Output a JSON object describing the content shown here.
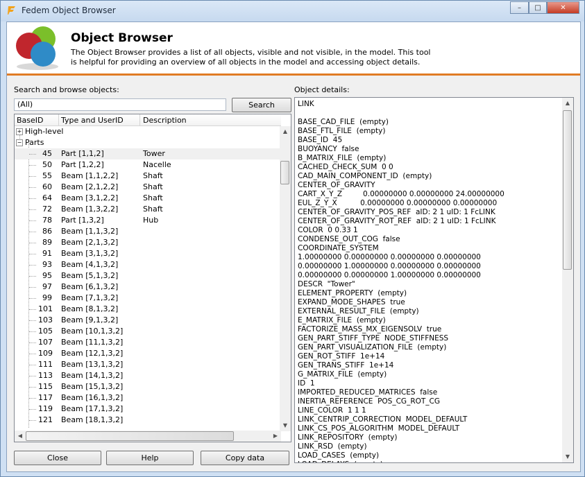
{
  "window": {
    "title": "Fedem Object Browser",
    "controls": {
      "minimize": "–",
      "maximize": "□",
      "close": "✕"
    }
  },
  "header": {
    "title": "Object Browser",
    "description_line1": "The Object Browser provides a list of all objects, visible and not visible, in the model. This tool",
    "description_line2": "is helpful for providing an overview of all objects in the model and accessing object details."
  },
  "search": {
    "label": "Search and browse objects:",
    "value": "(All)",
    "button": "Search"
  },
  "tree": {
    "columns": [
      "BaseID",
      "Type and UserID",
      "Description"
    ],
    "groups": [
      {
        "label": "High-level",
        "expander": "+"
      },
      {
        "label": "Parts",
        "expander": "−"
      }
    ],
    "rows": [
      {
        "id": "45",
        "type": "Part [1,1,2]",
        "desc": "Tower"
      },
      {
        "id": "50",
        "type": "Part [1,2,2]",
        "desc": "Nacelle"
      },
      {
        "id": "55",
        "type": "Beam [1,1,2,2]",
        "desc": "Shaft"
      },
      {
        "id": "60",
        "type": "Beam [2,1,2,2]",
        "desc": "Shaft"
      },
      {
        "id": "64",
        "type": "Beam [3,1,2,2]",
        "desc": "Shaft"
      },
      {
        "id": "72",
        "type": "Beam [1,3,2,2]",
        "desc": "Shaft"
      },
      {
        "id": "78",
        "type": "Part [1,3,2]",
        "desc": "Hub"
      },
      {
        "id": "86",
        "type": "Beam [1,1,3,2]",
        "desc": ""
      },
      {
        "id": "89",
        "type": "Beam [2,1,3,2]",
        "desc": ""
      },
      {
        "id": "91",
        "type": "Beam [3,1,3,2]",
        "desc": ""
      },
      {
        "id": "93",
        "type": "Beam [4,1,3,2]",
        "desc": ""
      },
      {
        "id": "95",
        "type": "Beam [5,1,3,2]",
        "desc": ""
      },
      {
        "id": "97",
        "type": "Beam [6,1,3,2]",
        "desc": ""
      },
      {
        "id": "99",
        "type": "Beam [7,1,3,2]",
        "desc": ""
      },
      {
        "id": "101",
        "type": "Beam [8,1,3,2]",
        "desc": ""
      },
      {
        "id": "103",
        "type": "Beam [9,1,3,2]",
        "desc": ""
      },
      {
        "id": "105",
        "type": "Beam [10,1,3,2]",
        "desc": ""
      },
      {
        "id": "107",
        "type": "Beam [11,1,3,2]",
        "desc": ""
      },
      {
        "id": "109",
        "type": "Beam [12,1,3,2]",
        "desc": ""
      },
      {
        "id": "111",
        "type": "Beam [13,1,3,2]",
        "desc": ""
      },
      {
        "id": "113",
        "type": "Beam [14,1,3,2]",
        "desc": ""
      },
      {
        "id": "115",
        "type": "Beam [15,1,3,2]",
        "desc": ""
      },
      {
        "id": "117",
        "type": "Beam [16,1,3,2]",
        "desc": ""
      },
      {
        "id": "119",
        "type": "Beam [17,1,3,2]",
        "desc": ""
      },
      {
        "id": "121",
        "type": "Beam [18,1,3,2]",
        "desc": ""
      }
    ]
  },
  "details": {
    "label": "Object details:",
    "lines": [
      "LINK",
      "",
      "BASE_CAD_FILE  (empty)",
      "BASE_FTL_FILE  (empty)",
      "BASE_ID  45",
      "BUOYANCY  false",
      "B_MATRIX_FILE  (empty)",
      "CACHED_CHECK_SUM  0 0",
      "CAD_MAIN_COMPONENT_ID  (empty)",
      "CENTER_OF_GRAVITY",
      "CART_X_Y_Z         0.00000000 0.00000000 24.00000000",
      "EUL_Z_Y_X          0.00000000 0.00000000 0.00000000",
      "CENTER_OF_GRAVITY_POS_REF  aID: 2 1 uID: 1 FcLINK",
      "CENTER_OF_GRAVITY_ROT_REF  aID: 2 1 uID: 1 FcLINK",
      "COLOR  0 0.33 1",
      "CONDENSE_OUT_COG  false",
      "COORDINATE_SYSTEM",
      "1.00000000 0.00000000 0.00000000 0.00000000",
      "0.00000000 1.00000000 0.00000000 0.00000000",
      "0.00000000 0.00000000 1.00000000 0.00000000",
      "DESCR  \"Tower\"",
      "ELEMENT_PROPERTY  (empty)",
      "EXPAND_MODE_SHAPES  true",
      "EXTERNAL_RESULT_FILE  (empty)",
      "E_MATRIX_FILE  (empty)",
      "FACTORIZE_MASS_MX_EIGENSOLV  true",
      "GEN_PART_STIFF_TYPE  NODE_STIFFNESS",
      "GEN_PART_VISUALIZATION_FILE  (empty)",
      "GEN_ROT_STIFF  1e+14",
      "GEN_TRANS_STIFF  1e+14",
      "G_MATRIX_FILE  (empty)",
      "ID  1",
      "IMPORTED_REDUCED_MATRICES  false",
      "INERTIA_REFERENCE  POS_CG_ROT_CG",
      "LINE_COLOR  1 1 1",
      "LINK_CENTRIP_CORRECTION  MODEL_DEFAULT",
      "LINK_CS_POS_ALGORITHM  MODEL_DEFAULT",
      "LINK_REPOSITORY  (empty)",
      "LINK_RSD  (empty)",
      "LOAD_CASES  (empty)",
      "LOAD_DELAYS  (empty)"
    ]
  },
  "buttons": {
    "close": "Close",
    "help": "Help",
    "copy": "Copy data"
  },
  "colors": {
    "accent": "#e07b24",
    "selection": "#f0f0f0"
  }
}
